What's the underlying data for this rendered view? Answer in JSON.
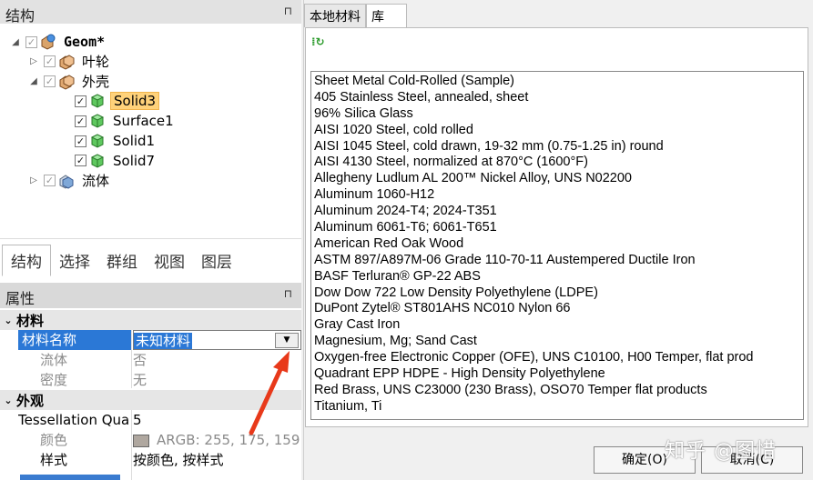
{
  "structure": {
    "title": "结构",
    "tree": [
      {
        "label": "Geom*",
        "level": 0,
        "expander": "◢",
        "checked": true
      },
      {
        "label": "叶轮",
        "level": 1,
        "expander": "▷",
        "checked": true
      },
      {
        "label": "外壳",
        "level": 1,
        "expander": "◢",
        "checked": true
      },
      {
        "label": "Solid3",
        "level": 2,
        "checked": true,
        "selected": true
      },
      {
        "label": "Surface1",
        "level": 2,
        "checked": true
      },
      {
        "label": "Solid1",
        "level": 2,
        "checked": true
      },
      {
        "label": "Solid7",
        "level": 2,
        "checked": true
      },
      {
        "label": "流体",
        "level": 1,
        "expander": "▷",
        "checked": true
      }
    ]
  },
  "bottom_tabs": [
    "结构",
    "选择",
    "群组",
    "视图",
    "图层"
  ],
  "properties": {
    "title": "属性",
    "material_section": "材料",
    "material_name_label": "材料名称",
    "material_name_value": "未知材料",
    "fluid_label": "流体",
    "fluid_value": "否",
    "density_label": "密度",
    "density_value": "无",
    "appearance_section": "外观",
    "tessellation_label": "Tessellation Qua",
    "tessellation_value": "5",
    "color_label": "颜色",
    "color_value": "ARGB: 255, 175, 159",
    "color_swatch": "#afa79f",
    "style_label": "样式",
    "style_value": "按颜色, 按样式"
  },
  "library": {
    "tabs": [
      "本地材料",
      "库"
    ],
    "materials": [
      "Sheet Metal Cold-Rolled (Sample)",
      "405 Stainless Steel, annealed, sheet",
      "96% Silica Glass",
      "AISI 1020 Steel, cold rolled",
      "AISI 1045 Steel, cold drawn, 19-32 mm (0.75-1.25 in) round",
      "AISI 4130 Steel, normalized at 870°C (1600°F)",
      "Allegheny Ludlum AL 200™ Nickel Alloy, UNS N02200",
      "Aluminum 1060-H12",
      "Aluminum 2024-T4; 2024-T351",
      "Aluminum 6061-T6; 6061-T651",
      "American Red Oak Wood",
      "ASTM 897/A897M-06 Grade 110-70-11 Austempered Ductile Iron",
      "BASF Terluran® GP-22 ABS",
      "Dow Dow 722 Low Density Polyethylene (LDPE)",
      "DuPont Zytel® ST801AHS NC010 Nylon 66",
      "Gray Cast Iron",
      "Magnesium, Mg; Sand Cast",
      "Oxygen-free Electronic Copper (OFE), UNS C10100, H00 Temper, flat prod",
      "Quadrant EPP HDPE - High Density Polyethylene",
      "Red Brass, UNS C23000 (230 Brass), OSO70 Temper flat products",
      "Titanium, Ti"
    ],
    "ok_label": "确定(O)",
    "cancel_label": "取消(C)",
    "watermark": "知乎 @图惜"
  },
  "colors": {
    "selection_blue": "#2b78d6",
    "tree_highlight": "#ffd27a",
    "annotation_arrow": "#e8391a"
  }
}
